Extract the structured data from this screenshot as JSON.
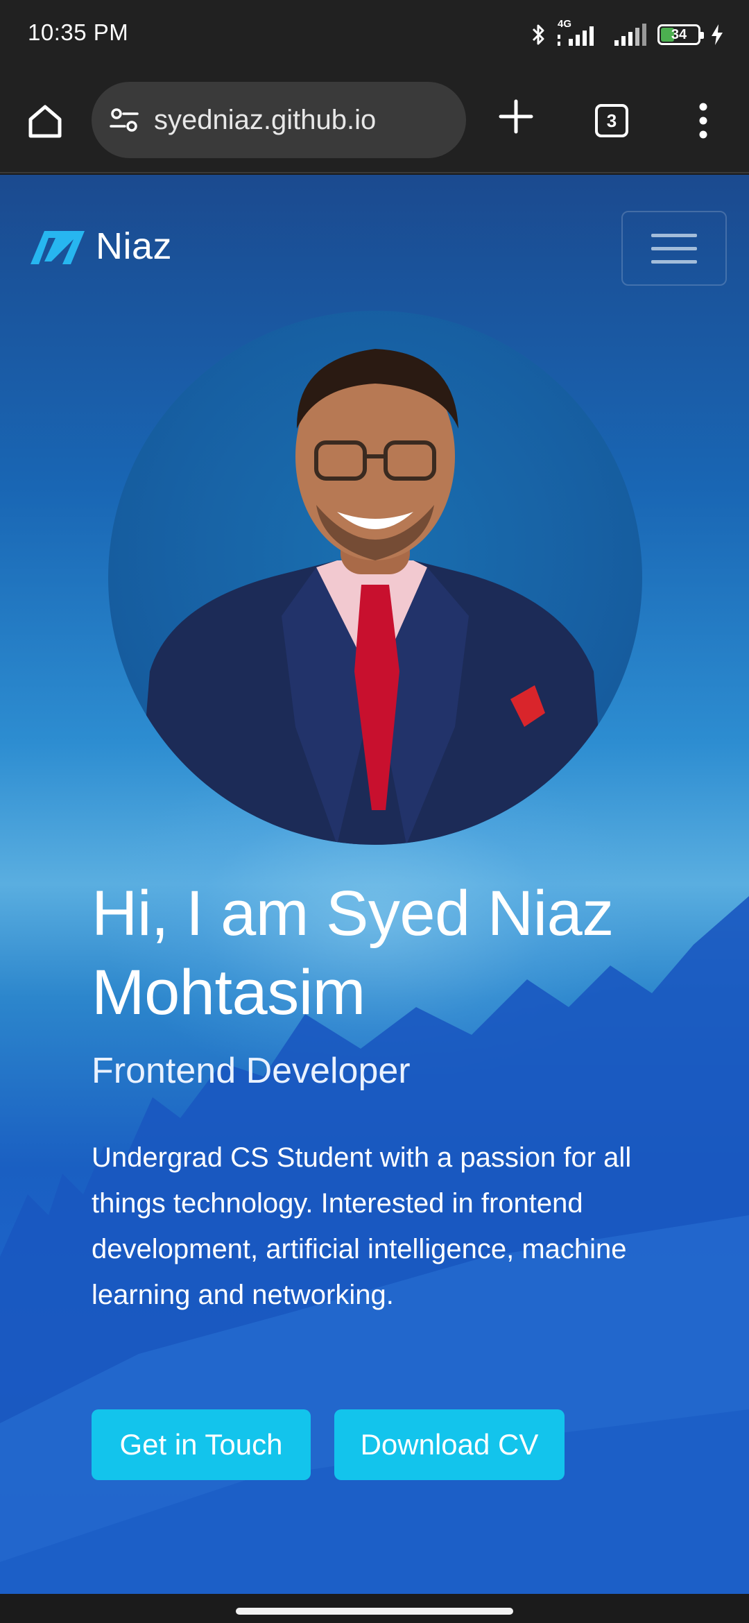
{
  "status_bar": {
    "time": "10:35 PM",
    "network_label": "4G",
    "battery_level": "34",
    "icons": [
      "bluetooth-icon",
      "signal-icon",
      "signal-icon",
      "battery-icon",
      "charging-icon"
    ]
  },
  "browser": {
    "url": "syedniaz.github.io",
    "tab_count": "3",
    "icons": [
      "home-icon",
      "site-settings-icon",
      "plus-icon",
      "tab-switcher-icon",
      "more-vert-icon"
    ]
  },
  "site": {
    "brand": "Niaz",
    "hero": {
      "title": "Hi, I am Syed Niaz Mohtasim",
      "subtitle": "Frontend Developer",
      "description": "Undergrad CS Student with a passion for all things technology. Interested in frontend development, artificial intelligence, machine learning and networking.",
      "buttons": {
        "contact": "Get in Touch",
        "cv": "Download CV"
      }
    }
  },
  "colors": {
    "accent": "#13c4ec",
    "chrome_bg": "#212121",
    "url_box_bg": "#3a3a3a",
    "battery_green": "#4caf50",
    "tie_red": "#c8102e"
  }
}
